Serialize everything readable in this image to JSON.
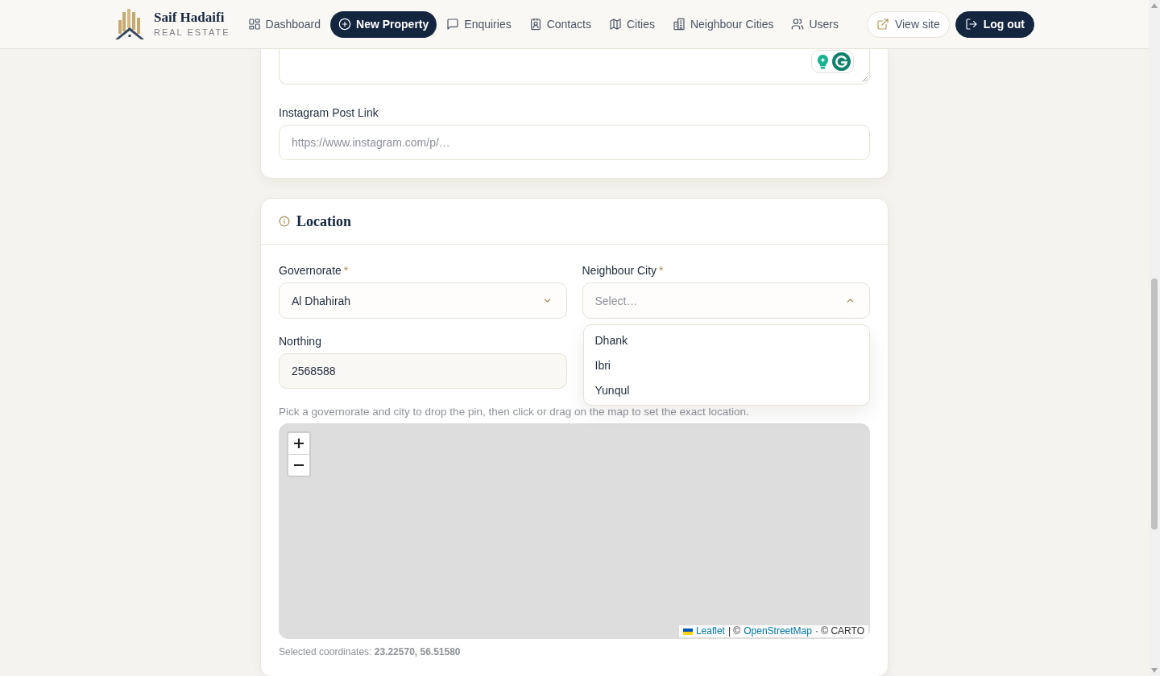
{
  "header": {
    "brand": {
      "name": "Saif Hadaifi",
      "tagline": "REAL ESTATE"
    },
    "nav": [
      {
        "label": "Dashboard",
        "selected": false
      },
      {
        "label": "New Property",
        "selected": true
      },
      {
        "label": "Enquiries",
        "selected": false
      },
      {
        "label": "Contacts",
        "selected": false
      },
      {
        "label": "Cities",
        "selected": false
      },
      {
        "label": "Neighbour Cities",
        "selected": false
      },
      {
        "label": "Users",
        "selected": false
      }
    ],
    "actions": [
      {
        "label": "View site",
        "kind": "outline"
      },
      {
        "label": "Log out",
        "kind": "solid"
      }
    ]
  },
  "details_card": {
    "fields": [
      {
        "kind": "textarea"
      },
      {
        "kind": "text",
        "label": "Instagram Post Link",
        "placeholder": "https://www.instagram.com/p/…"
      }
    ]
  },
  "location_card": {
    "title": "Location",
    "fields": [
      {
        "kind": "select",
        "label": "Governorate",
        "required_mark": "*",
        "value": "Al Dhahirah",
        "expanded": false
      },
      {
        "kind": "select",
        "label": "Neighbour City",
        "required_mark": "*",
        "placeholder": "Select…",
        "expanded": true,
        "options": [
          {
            "label": "Dhank",
            "selected": false
          },
          {
            "label": "Ibri",
            "selected": false
          },
          {
            "label": "Yunqul",
            "selected": false
          }
        ]
      },
      {
        "kind": "text",
        "label": "Northing",
        "value": "2568588"
      }
    ],
    "hint": "Pick a governorate and city to drop the pin, then click or drag on the map to set the exact location.",
    "map": {
      "attribution": [
        {
          "kind": "flag-link",
          "text": "Leaflet"
        },
        {
          "kind": "text",
          "text": "| ©"
        },
        {
          "kind": "link",
          "text": "OpenStreetMap"
        },
        {
          "kind": "text",
          "text": "· © CARTO"
        }
      ]
    },
    "selected_coordinates": "Selected coordinates: **23.22570, 56.51580**"
  }
}
